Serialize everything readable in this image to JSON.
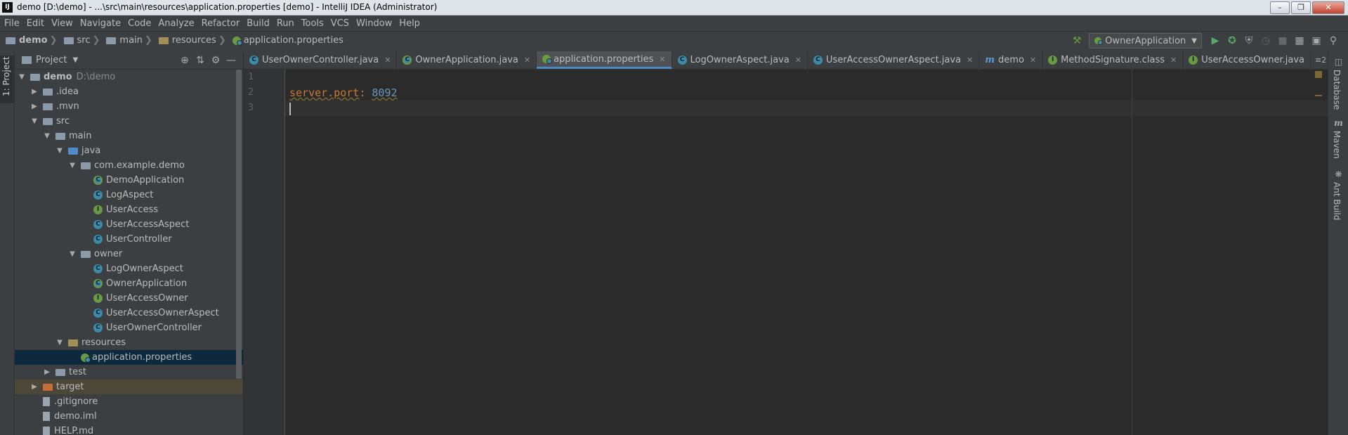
{
  "window": {
    "title": "demo [D:\\demo] - ...\\src\\main\\resources\\application.properties [demo] - IntelliJ IDEA (Administrator)",
    "app_icon": "IJ",
    "controls": [
      "minimize",
      "maximize",
      "close"
    ]
  },
  "menu": [
    "File",
    "Edit",
    "View",
    "Navigate",
    "Code",
    "Analyze",
    "Refactor",
    "Build",
    "Run",
    "Tools",
    "VCS",
    "Window",
    "Help"
  ],
  "breadcrumbs": [
    {
      "label": "demo",
      "icon": "folder-icon"
    },
    {
      "label": "src",
      "icon": "folder-icon"
    },
    {
      "label": "main",
      "icon": "folder-icon"
    },
    {
      "label": "resources",
      "icon": "resources-folder-icon"
    },
    {
      "label": "application.properties",
      "icon": "spring-properties-icon"
    }
  ],
  "toolbar": {
    "run_config": "OwnerApplication",
    "buttons": [
      "build-hammer-icon",
      "run-icon",
      "debug-icon",
      "coverage-icon",
      "profile-icon",
      "stop-icon",
      "project-structure-icon",
      "sdk-icon",
      "search-everywhere-icon"
    ]
  },
  "left_strip": {
    "tab_label": "1: Project"
  },
  "project_panel": {
    "title": "Project",
    "header_icons": [
      "target-icon",
      "collapse-icon",
      "gear-icon",
      "hide-icon"
    ],
    "tree": [
      {
        "label": "demo",
        "suffix": "D:\\demo",
        "depth": 0,
        "expanded": true,
        "icon": "module",
        "bold": true
      },
      {
        "label": ".idea",
        "depth": 1,
        "expanded": false,
        "icon": "folder"
      },
      {
        "label": ".mvn",
        "depth": 1,
        "expanded": false,
        "icon": "folder"
      },
      {
        "label": "src",
        "depth": 1,
        "expanded": true,
        "icon": "folder"
      },
      {
        "label": "main",
        "depth": 2,
        "expanded": true,
        "icon": "folder"
      },
      {
        "label": "java",
        "depth": 3,
        "expanded": true,
        "icon": "source-folder"
      },
      {
        "label": "com.example.demo",
        "depth": 4,
        "expanded": true,
        "icon": "package"
      },
      {
        "label": "DemoApplication",
        "depth": 5,
        "icon": "spring-class"
      },
      {
        "label": "LogAspect",
        "depth": 5,
        "icon": "class"
      },
      {
        "label": "UserAccess",
        "depth": 5,
        "icon": "interface"
      },
      {
        "label": "UserAccessAspect",
        "depth": 5,
        "icon": "class"
      },
      {
        "label": "UserController",
        "depth": 5,
        "icon": "class"
      },
      {
        "label": "owner",
        "depth": 4,
        "expanded": true,
        "icon": "package"
      },
      {
        "label": "LogOwnerAspect",
        "depth": 5,
        "icon": "class"
      },
      {
        "label": "OwnerApplication",
        "depth": 5,
        "icon": "spring-class"
      },
      {
        "label": "UserAccessOwner",
        "depth": 5,
        "icon": "interface"
      },
      {
        "label": "UserAccessOwnerAspect",
        "depth": 5,
        "icon": "class"
      },
      {
        "label": "UserOwnerController",
        "depth": 5,
        "icon": "class"
      },
      {
        "label": "resources",
        "depth": 3,
        "expanded": true,
        "icon": "resources-folder"
      },
      {
        "label": "application.properties",
        "depth": 4,
        "icon": "spring-properties",
        "selected": true
      },
      {
        "label": "test",
        "depth": 2,
        "expanded": false,
        "icon": "folder"
      },
      {
        "label": "target",
        "depth": 1,
        "expanded": false,
        "icon": "excluded-folder",
        "excluded": true
      },
      {
        "label": ".gitignore",
        "depth": 1,
        "icon": "file"
      },
      {
        "label": "demo.iml",
        "depth": 1,
        "icon": "file"
      },
      {
        "label": "HELP.md",
        "depth": 1,
        "icon": "file"
      }
    ]
  },
  "editor_tabs": [
    {
      "label": "UserOwnerController.java",
      "icon": "class"
    },
    {
      "label": "OwnerApplication.java",
      "icon": "spring-class"
    },
    {
      "label": "application.properties",
      "icon": "spring-properties",
      "active": true
    },
    {
      "label": "LogOwnerAspect.java",
      "icon": "class"
    },
    {
      "label": "UserAccessOwnerAspect.java",
      "icon": "class"
    },
    {
      "label": "demo",
      "icon": "maven"
    },
    {
      "label": "MethodSignature.class",
      "icon": "interface-compiled"
    },
    {
      "label": "UserAccessOwner.java",
      "icon": "interface",
      "no_close": true
    }
  ],
  "tab_overflow": "≡2",
  "editor": {
    "line_numbers": [
      "1",
      "2",
      "3"
    ],
    "lines": [
      {
        "key": "",
        "sep": "",
        "value": ""
      },
      {
        "key": "server.port",
        "sep": ": ",
        "value": "8092"
      },
      {
        "key": "",
        "sep": "",
        "value": "",
        "caret": true
      }
    ]
  },
  "right_strip": [
    {
      "label": "Database",
      "icon": "database-icon"
    },
    {
      "label": "Maven",
      "icon": "maven-icon"
    },
    {
      "label": "Ant Build",
      "icon": "ant-icon"
    }
  ]
}
